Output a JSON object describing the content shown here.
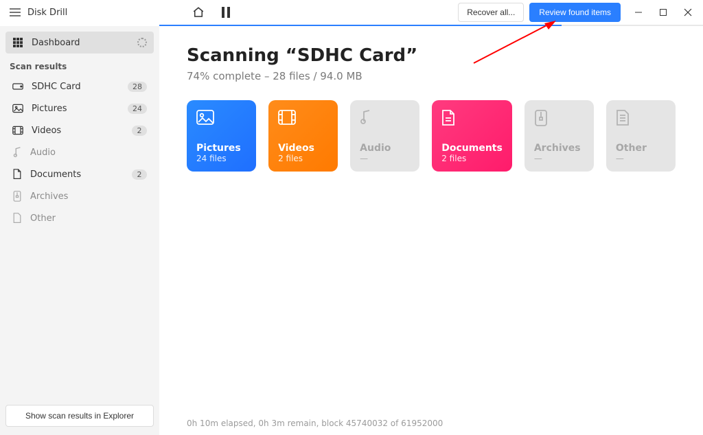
{
  "app_title": "Disk Drill",
  "toolbar": {
    "recover_all_label": "Recover all...",
    "review_label": "Review found items"
  },
  "sidebar": {
    "dashboard_label": "Dashboard",
    "scan_results_label": "Scan results",
    "bottom_button": "Show scan results in Explorer",
    "items": [
      {
        "label": "SDHC Card",
        "count": "28",
        "muted": false
      },
      {
        "label": "Pictures",
        "count": "24",
        "muted": false
      },
      {
        "label": "Videos",
        "count": "2",
        "muted": false
      },
      {
        "label": "Audio",
        "count": "",
        "muted": true
      },
      {
        "label": "Documents",
        "count": "2",
        "muted": false
      },
      {
        "label": "Archives",
        "count": "",
        "muted": true
      },
      {
        "label": "Other",
        "count": "",
        "muted": true
      }
    ]
  },
  "main": {
    "heading": "Scanning “SDHC Card”",
    "subheading": "74% complete – 28 files / 94.0 MB",
    "tiles": [
      {
        "name": "Pictures",
        "count": "24 files"
      },
      {
        "name": "Videos",
        "count": "2 files"
      },
      {
        "name": "Audio",
        "count": "—"
      },
      {
        "name": "Documents",
        "count": "2 files"
      },
      {
        "name": "Archives",
        "count": "—"
      },
      {
        "name": "Other",
        "count": "—"
      }
    ],
    "status": "0h 10m elapsed, 0h 3m remain, block 45740032 of 61952000"
  }
}
